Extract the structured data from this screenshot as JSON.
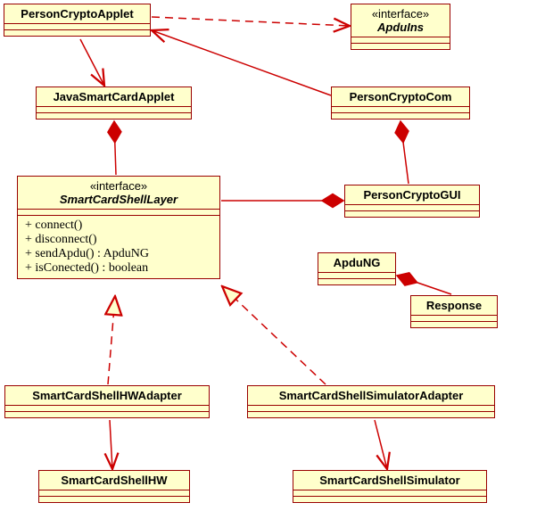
{
  "classes": {
    "personCryptoApplet": {
      "name": "PersonCryptoApplet"
    },
    "apduIns": {
      "stereotype": "«interface»",
      "name": "ApduIns"
    },
    "javaSmartCardApplet": {
      "name": "JavaSmartCardApplet"
    },
    "personCryptoCom": {
      "name": "PersonCryptoCom"
    },
    "smartCardShellLayer": {
      "stereotype": "«interface»",
      "name": "SmartCardShellLayer",
      "ops": [
        "+ connect()",
        "+ disconnect()",
        "+ sendApdu() : ApduNG",
        "+ isConected() : boolean"
      ]
    },
    "personCryptoGUI": {
      "name": "PersonCryptoGUI"
    },
    "apduNG": {
      "name": "ApduNG"
    },
    "response": {
      "name": "Response"
    },
    "smartCardShellHWAdapter": {
      "name": "SmartCardShellHWAdapter"
    },
    "smartCardShellSimulatorAdapter": {
      "name": "SmartCardShellSimulatorAdapter"
    },
    "smartCardShellHW": {
      "name": "SmartCardShellHW"
    },
    "smartCardShellSimulator": {
      "name": "SmartCardShellSimulator"
    }
  },
  "chart_data": {
    "type": "table",
    "title": "UML Class Diagram",
    "nodes": [
      {
        "id": "PersonCryptoApplet",
        "kind": "class"
      },
      {
        "id": "ApduIns",
        "kind": "interface"
      },
      {
        "id": "JavaSmartCardApplet",
        "kind": "class"
      },
      {
        "id": "PersonCryptoCom",
        "kind": "class"
      },
      {
        "id": "SmartCardShellLayer",
        "kind": "interface",
        "operations": [
          "+ connect()",
          "+ disconnect()",
          "+ sendApdu() : ApduNG",
          "+ isConected() : boolean"
        ]
      },
      {
        "id": "PersonCryptoGUI",
        "kind": "class"
      },
      {
        "id": "ApduNG",
        "kind": "class"
      },
      {
        "id": "Response",
        "kind": "class"
      },
      {
        "id": "SmartCardShellHWAdapter",
        "kind": "class"
      },
      {
        "id": "SmartCardShellSimulatorAdapter",
        "kind": "class"
      },
      {
        "id": "SmartCardShellHW",
        "kind": "class"
      },
      {
        "id": "SmartCardShellSimulator",
        "kind": "class"
      }
    ],
    "edges": [
      {
        "from": "PersonCryptoApplet",
        "to": "ApduIns",
        "type": "realization"
      },
      {
        "from": "PersonCryptoApplet",
        "to": "JavaSmartCardApplet",
        "type": "association"
      },
      {
        "from": "PersonCryptoCom",
        "to": "PersonCryptoApplet",
        "type": "association"
      },
      {
        "from": "PersonCryptoCom",
        "to": "PersonCryptoGUI",
        "type": "composition"
      },
      {
        "from": "JavaSmartCardApplet",
        "to": "SmartCardShellLayer",
        "type": "composition"
      },
      {
        "from": "PersonCryptoGUI",
        "to": "SmartCardShellLayer",
        "type": "composition"
      },
      {
        "from": "ApduNG",
        "to": "Response",
        "type": "composition"
      },
      {
        "from": "SmartCardShellHWAdapter",
        "to": "SmartCardShellLayer",
        "type": "realization"
      },
      {
        "from": "SmartCardShellSimulatorAdapter",
        "to": "SmartCardShellLayer",
        "type": "realization"
      },
      {
        "from": "SmartCardShellHWAdapter",
        "to": "SmartCardShellHW",
        "type": "association"
      },
      {
        "from": "SmartCardShellSimulatorAdapter",
        "to": "SmartCardShellSimulator",
        "type": "association"
      }
    ]
  }
}
